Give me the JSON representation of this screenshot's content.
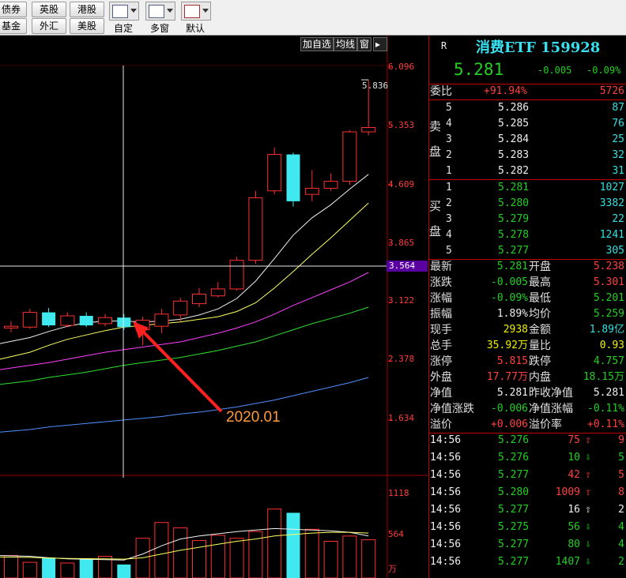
{
  "toolbar": {
    "buttons_row1": [
      "债券",
      "英股",
      "港股"
    ],
    "buttons_row2": [
      "基金",
      "外汇",
      "美股"
    ],
    "tools": [
      "自定",
      "多窗",
      "默认"
    ]
  },
  "chart_tabs": [
    "加自选",
    "均线",
    "窗"
  ],
  "price_scale": [
    "6.096",
    "5.353",
    "4.609",
    "3.865",
    "3.122",
    "2.378",
    "1.634"
  ],
  "crosshair_price": "3.564",
  "volume_scale": [
    "1118",
    "564",
    "万"
  ],
  "max_label": "5.836",
  "annotation": "2020.01",
  "header": {
    "marker": "R",
    "title": "消费ETF 159928",
    "price": "5.281",
    "change": "-0.005",
    "change_pct": "-0.09%"
  },
  "weibi": {
    "label": "委比",
    "pct": "+91.94%",
    "diff": "5726"
  },
  "sell_label": [
    "卖",
    "盘"
  ],
  "buy_label": [
    "买",
    "盘"
  ],
  "asks": [
    {
      "level": "5",
      "price": "5.286",
      "vol": "87"
    },
    {
      "level": "4",
      "price": "5.285",
      "vol": "76"
    },
    {
      "level": "3",
      "price": "5.284",
      "vol": "25"
    },
    {
      "level": "2",
      "price": "5.283",
      "vol": "32"
    },
    {
      "level": "1",
      "price": "5.282",
      "vol": "31"
    }
  ],
  "bids": [
    {
      "level": "1",
      "price": "5.281",
      "vol": "1027"
    },
    {
      "level": "2",
      "price": "5.280",
      "vol": "3382"
    },
    {
      "level": "3",
      "price": "5.279",
      "vol": "22"
    },
    {
      "level": "4",
      "price": "5.278",
      "vol": "1241"
    },
    {
      "level": "5",
      "price": "5.277",
      "vol": "305"
    }
  ],
  "stats": [
    {
      "l1": "最新",
      "v1": "5.281",
      "c1": "green",
      "l2": "开盘",
      "v2": "5.238",
      "c2": "red"
    },
    {
      "l1": "涨跌",
      "v1": "-0.005",
      "c1": "green",
      "l2": "最高",
      "v2": "5.301",
      "c2": "red"
    },
    {
      "l1": "涨幅",
      "v1": "-0.09%",
      "c1": "green",
      "l2": "最低",
      "v2": "5.201",
      "c2": "green"
    },
    {
      "l1": "振幅",
      "v1": "1.89%",
      "c1": "white",
      "l2": "均价",
      "v2": "5.259",
      "c2": "green"
    },
    {
      "l1": "现手",
      "v1": "2938",
      "c1": "yellow",
      "l2": "金额",
      "v2": "1.89亿",
      "c2": "cyan"
    },
    {
      "l1": "总手",
      "v1": "35.92万",
      "c1": "yellow",
      "l2": "量比",
      "v2": "0.93",
      "c2": "yellow"
    },
    {
      "l1": "涨停",
      "v1": "5.815",
      "c1": "red",
      "l2": "跌停",
      "v2": "4.757",
      "c2": "green"
    },
    {
      "l1": "外盘",
      "v1": "17.77万",
      "c1": "red",
      "l2": "内盘",
      "v2": "18.15万",
      "c2": "green"
    },
    {
      "l1": "净值",
      "v1": "5.281",
      "c1": "white",
      "l2": "昨收净值",
      "v2": "5.281",
      "c2": "white"
    },
    {
      "l1": "净值涨跌",
      "v1": "-0.006",
      "c1": "green",
      "l2": "净值涨幅",
      "v2": "-0.11%",
      "c2": "green"
    },
    {
      "l1": "溢价",
      "v1": "+0.006",
      "c1": "red",
      "l2": "溢价率",
      "v2": "+0.11%",
      "c2": "red"
    }
  ],
  "ticks": [
    {
      "time": "14:56",
      "price": "5.276",
      "vol": "75",
      "dir": "up",
      "tail": "9"
    },
    {
      "time": "14:56",
      "price": "5.276",
      "vol": "10",
      "dir": "down",
      "tail": "5"
    },
    {
      "time": "14:56",
      "price": "5.277",
      "vol": "42",
      "dir": "up",
      "tail": "5"
    },
    {
      "time": "14:56",
      "price": "5.280",
      "vol": "1009",
      "dir": "up",
      "tail": "8"
    },
    {
      "time": "14:56",
      "price": "5.277",
      "vol": "16",
      "dir": "flat",
      "tail": "2"
    },
    {
      "time": "14:56",
      "price": "5.275",
      "vol": "56",
      "dir": "down",
      "tail": "4"
    },
    {
      "time": "14:56",
      "price": "5.277",
      "vol": "80",
      "dir": "down",
      "tail": "4"
    },
    {
      "time": "14:56",
      "price": "5.277",
      "vol": "1407",
      "dir": "down",
      "tail": "2"
    }
  ],
  "chart_data": {
    "type": "candlestick",
    "candles": [
      {
        "o": 2.98,
        "c": 3.0,
        "h": 3.06,
        "l": 2.93
      },
      {
        "o": 2.99,
        "c": 3.16,
        "h": 3.2,
        "l": 2.97
      },
      {
        "o": 3.16,
        "c": 3.01,
        "h": 3.21,
        "l": 2.99
      },
      {
        "o": 3.01,
        "c": 3.12,
        "h": 3.16,
        "l": 2.99
      },
      {
        "o": 3.12,
        "c": 3.01,
        "h": 3.16,
        "l": 2.99
      },
      {
        "o": 3.03,
        "c": 3.1,
        "h": 3.14,
        "l": 3.0
      },
      {
        "o": 3.1,
        "c": 2.99,
        "h": 3.14,
        "l": 2.96
      },
      {
        "o": 2.96,
        "c": 3.07,
        "h": 3.11,
        "l": 2.78
      },
      {
        "o": 3.0,
        "c": 3.14,
        "h": 3.2,
        "l": 2.92
      },
      {
        "o": 3.13,
        "c": 3.29,
        "h": 3.33,
        "l": 3.05
      },
      {
        "o": 3.26,
        "c": 3.37,
        "h": 3.44,
        "l": 3.22
      },
      {
        "o": 3.35,
        "c": 3.43,
        "h": 3.51,
        "l": 3.33
      },
      {
        "o": 3.43,
        "c": 3.76,
        "h": 3.8,
        "l": 3.41
      },
      {
        "o": 3.76,
        "c": 4.48,
        "h": 4.56,
        "l": 3.72
      },
      {
        "o": 4.56,
        "c": 4.98,
        "h": 5.06,
        "l": 4.52
      },
      {
        "o": 4.98,
        "c": 4.44,
        "h": 5.0,
        "l": 4.38
      },
      {
        "o": 4.52,
        "c": 4.59,
        "h": 4.8,
        "l": 4.44
      },
      {
        "o": 4.59,
        "c": 4.67,
        "h": 4.76,
        "l": 4.56
      },
      {
        "o": 4.67,
        "c": 5.24,
        "h": 5.26,
        "l": 4.63
      },
      {
        "o": 5.24,
        "c": 5.29,
        "h": 5.84,
        "l": 5.2
      }
    ],
    "ma": [
      {
        "color": "#f0f0f0",
        "values": [
          2.8,
          2.87,
          2.94,
          3.0,
          3.04,
          3.06,
          3.06,
          3.05,
          3.06,
          3.08,
          3.13,
          3.2,
          3.32,
          3.52,
          3.78,
          4.05,
          4.25,
          4.4,
          4.58,
          4.75
        ]
      },
      {
        "color": "#ffff60",
        "values": [
          2.62,
          2.7,
          2.78,
          2.85,
          2.9,
          2.95,
          2.99,
          3.01,
          3.03,
          3.05,
          3.08,
          3.11,
          3.17,
          3.27,
          3.44,
          3.63,
          3.83,
          4.02,
          4.22,
          4.42
        ]
      },
      {
        "color": "#ff40ff",
        "values": [
          2.5,
          2.55,
          2.58,
          2.62,
          2.66,
          2.7,
          2.73,
          2.76,
          2.79,
          2.82,
          2.87,
          2.92,
          2.98,
          3.05,
          3.14,
          3.24,
          3.33,
          3.42,
          3.51,
          3.62
        ]
      },
      {
        "color": "#30e030",
        "values": [
          2.33,
          2.37,
          2.41,
          2.44,
          2.47,
          2.51,
          2.55,
          2.58,
          2.61,
          2.64,
          2.68,
          2.72,
          2.77,
          2.82,
          2.89,
          2.96,
          3.03,
          3.09,
          3.15,
          3.22
        ]
      },
      {
        "color": "#5090ff",
        "values": [
          1.78,
          1.81,
          1.84,
          1.86,
          1.88,
          1.9,
          1.92,
          1.94,
          1.96,
          1.99,
          2.01,
          2.04,
          2.07,
          2.11,
          2.15,
          2.2,
          2.25,
          2.3,
          2.35,
          2.41
        ]
      }
    ],
    "volume": [
      300,
      210,
      270,
      200,
      250,
      290,
      180,
      530,
      740,
      670,
      500,
      570,
      530,
      620,
      920,
      870,
      650,
      490,
      560,
      510
    ],
    "volume_ma": [
      {
        "color": "#f0f0f0",
        "values": [
          300,
          290,
          270,
          255,
          250,
          245,
          240,
          320,
          430,
          520,
          560,
          590,
          620,
          640,
          660,
          650,
          640,
          630,
          610,
          560
        ]
      },
      {
        "color": "#ffff60",
        "values": [
          280,
          275,
          265,
          260,
          258,
          255,
          252,
          270,
          320,
          370,
          410,
          450,
          490,
          520,
          560,
          580,
          600,
          610,
          610,
          600
        ]
      }
    ],
    "price_range": [
      1.3,
      6.35
    ],
    "volume_range": [
      0,
      1180
    ]
  }
}
